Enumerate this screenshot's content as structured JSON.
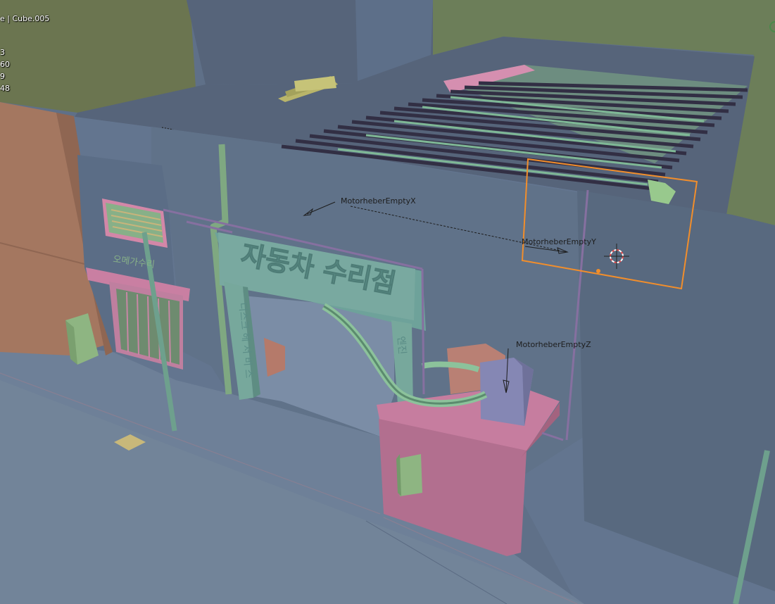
{
  "viewport": {
    "object_info": "e | Cube.005",
    "stats": [
      "3",
      "60",
      "9",
      "48"
    ]
  },
  "scene_labels": {
    "empty_x": "MotorheberEmptyX",
    "empty_y": "MotorheberEmptyY",
    "empty_z": "MotorheberEmptyZ"
  },
  "signs": {
    "main_sign": "자동차 수리점",
    "left_pillar": "디스크 헤 서 비 스",
    "right_pillar": "엔진",
    "shop_sign": "오메가수리"
  },
  "colors": {
    "selection_outline": "#f28e2b",
    "background": "#5f7088"
  }
}
